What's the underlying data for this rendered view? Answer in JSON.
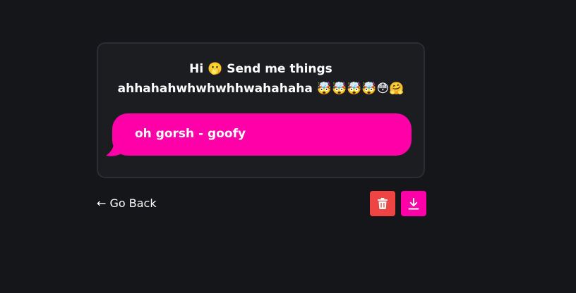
{
  "card": {
    "prompt_line1": "Hi 🫢 Send me things",
    "prompt_line2": "ahhahahwhwhwhhwahahaha 🤯🤯🤯🤯😳🤗",
    "message": "oh gorsh - goofy"
  },
  "nav": {
    "back_label": "← Go Back"
  },
  "actions": {
    "delete_icon": "trash-icon",
    "download_icon": "download-icon"
  },
  "colors": {
    "background": "#151619",
    "card": "#1c1d21",
    "accent": "#ff00a8",
    "delete": "#ef4444"
  }
}
